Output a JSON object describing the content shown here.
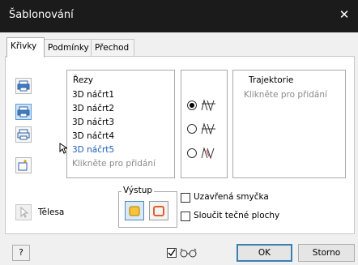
{
  "window": {
    "title": "Šablonování",
    "close_glyph": "✕"
  },
  "tabs": [
    {
      "label": "Křivky",
      "active": true
    },
    {
      "label": "Podmínky",
      "active": false
    },
    {
      "label": "Přechod",
      "active": false
    }
  ],
  "sections": {
    "header": "Řezy",
    "items": [
      "3D náčrt1",
      "3D náčrt2",
      "3D náčrt3",
      "3D náčrt4",
      "3D náčrt5"
    ],
    "highlighted_index": 4,
    "add_hint": "Klikněte pro přidání"
  },
  "rails": {
    "header": "Trajektorie",
    "add_hint": "Klikněte pro přidání"
  },
  "mode_options": {
    "selected": "rails",
    "icons": [
      "rails-icon",
      "center-line-icon",
      "area-loft-icon"
    ]
  },
  "output": {
    "label": "Výstup",
    "options": [
      "solid-icon",
      "surface-icon"
    ],
    "selected": "solid-icon"
  },
  "bodies": {
    "label": "Tělesa"
  },
  "checkboxes": {
    "closed_loop": {
      "label": "Uzavřená smyčka",
      "checked": false
    },
    "merge_tangent": {
      "label": "Sloučit tečné plochy",
      "checked": false
    }
  },
  "footer": {
    "preview_checked": true,
    "ok_label": "OK",
    "cancel_label": "Storno",
    "help_glyph": "?"
  },
  "colors": {
    "titlebar": "#1b1b1b",
    "accent": "#1a5fbf",
    "selected_tool": "#cde4f7"
  }
}
